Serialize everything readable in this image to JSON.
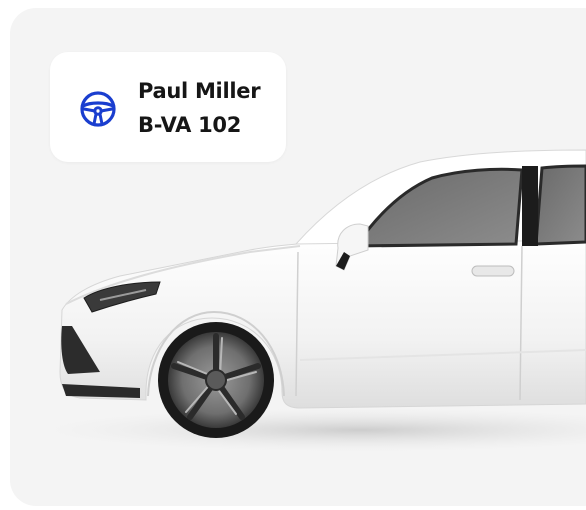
{
  "driver_card": {
    "icon": "steering-wheel-icon",
    "name": "Paul Miller",
    "plate": "B-VA 102"
  },
  "colors": {
    "icon_blue": "#1a3ecf",
    "background": "#f4f4f4",
    "card": "#ffffff",
    "text": "#161616"
  }
}
